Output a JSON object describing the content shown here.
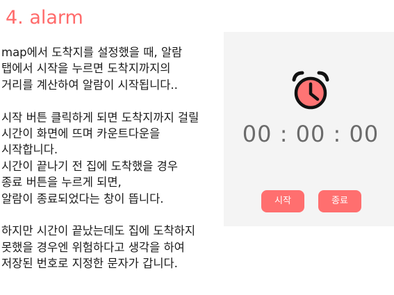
{
  "section": {
    "title": "4. alarm"
  },
  "description": {
    "lines": [
      "map에서 도착지를 설정했을 때, 알람",
      "탭에서 시작을 누르면 도착지까지의",
      "거리를 계산하여 알람이 시작됩니다..",
      "",
      "시작 버튼 클릭하게 되면 도착지까지 걸릴",
      "시간이 화면에 뜨며 카운트다운을",
      "시작합니다.",
      "시간이 끝나기 전 집에 도착했을 경우",
      "종료 버튼을 누르게 되면,",
      "알람이 종료되었다는 창이 뜹니다.",
      "",
      "하지만 시간이 끝났는데도 집에 도착하지",
      "못했을 경우엔 위험하다고 생각을 하여",
      "저장된 번호로 지정한 문자가 갑니다."
    ]
  },
  "alarm_screen": {
    "icon": "alarm-clock-icon",
    "timer": "00 : 00 : 00",
    "start_label": "시작",
    "stop_label": "종료"
  },
  "colors": {
    "accent": "#ff6b6b",
    "icon_fill": "#ff7474",
    "button": "#ff6f6f",
    "timer_text": "#6b6b6b",
    "panel_bg": "#f4f4f4"
  }
}
